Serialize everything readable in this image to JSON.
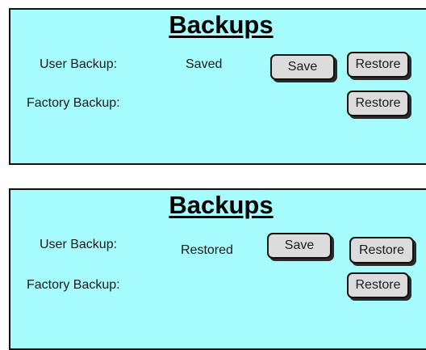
{
  "panels": [
    {
      "title": "Backups",
      "user_backup_label": "User Backup:",
      "user_backup_status": "Saved",
      "factory_backup_label": "Factory Backup:",
      "save_label": "Save",
      "restore_user_label": "Restore",
      "restore_factory_label": "Restore"
    },
    {
      "title": "Backups",
      "user_backup_label": "User Backup:",
      "user_backup_status": "Restored",
      "factory_backup_label": "Factory Backup:",
      "save_label": "Save",
      "restore_user_label": "Restore",
      "restore_factory_label": "Restore"
    }
  ],
  "colors": {
    "panel_background": "#a6fbfd",
    "button_background": "#dcdcdc",
    "border": "#111111"
  }
}
